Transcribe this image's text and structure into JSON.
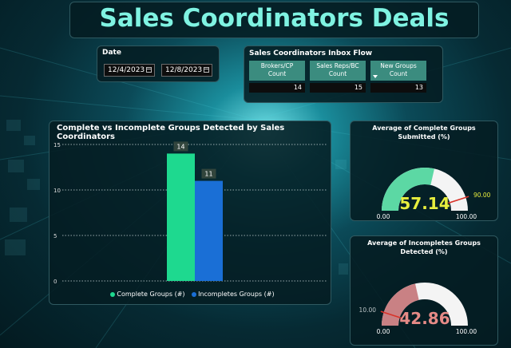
{
  "header": {
    "title": "Sales Coordinators Deals"
  },
  "date_filter": {
    "label": "Date",
    "start": "12/4/2023",
    "end": "12/8/2023"
  },
  "inbox": {
    "title": "Sales Coordinators Inbox Flow",
    "columns": [
      {
        "label_line1": "Brokers/CP",
        "label_line2": "Count",
        "value": "14"
      },
      {
        "label_line1": "Sales Reps/BC",
        "label_line2": "Count",
        "value": "15"
      },
      {
        "label_line1": "New Groups",
        "label_line2": "Count",
        "value": "13"
      }
    ]
  },
  "chart_data": {
    "type": "bar",
    "title": "Complete vs Incomplete Groups Detected by Sales Coordinators",
    "series": [
      {
        "name": "Complete Groups (#)",
        "values": [
          14
        ],
        "color": "#1ed98f"
      },
      {
        "name": "Incompletes Groups (#)",
        "values": [
          11
        ],
        "color": "#1a6fd6"
      }
    ],
    "data_labels": [
      "14",
      "11"
    ],
    "yticks": [
      "15",
      "10",
      "5",
      "0"
    ],
    "ylim": [
      0,
      15
    ],
    "grid": true,
    "legend_position": "bottom"
  },
  "gauges": [
    {
      "title_line1": "Average of Complete Groups",
      "title_line2": "Submitted (%)",
      "value": 57.14,
      "value_label": "57.14",
      "min_label": "0.00",
      "max_label": "100.00",
      "target": 90,
      "target_label": "90.00",
      "fill_color": "#5cd8a4",
      "value_color": "#e8ee3e"
    },
    {
      "title_line1": "Average of Incompletes Groups",
      "title_line2": "Detected (%)",
      "value": 42.86,
      "value_label": "42.86",
      "min_label": "0.00",
      "max_label": "100.00",
      "target": 10,
      "target_label": "10.00",
      "fill_color": "#c98184",
      "value_color": "#e58a86"
    }
  ]
}
